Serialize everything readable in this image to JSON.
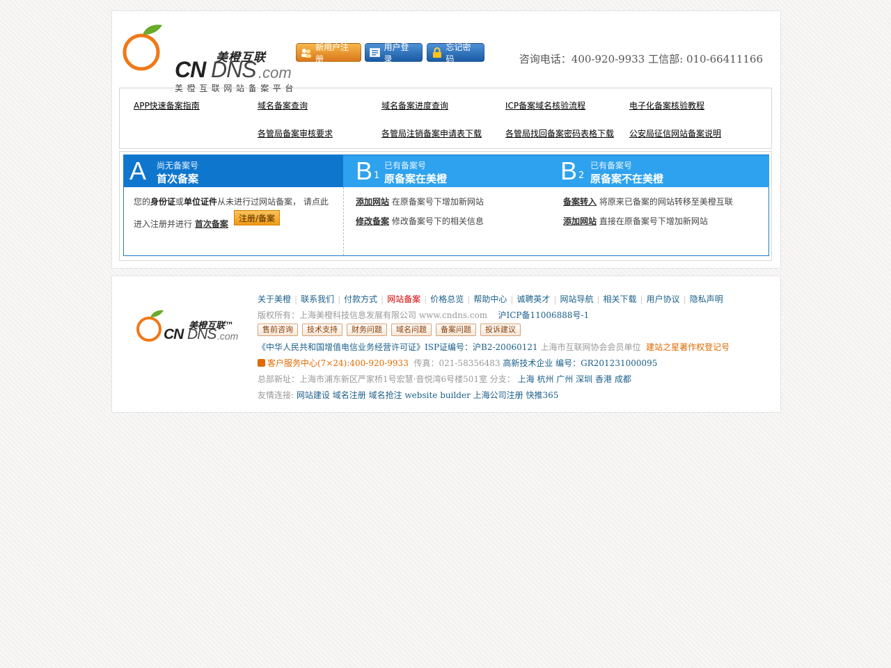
{
  "header": {
    "logo": {
      "title": "美橙互联",
      "cn": "CN",
      "dns": "DNS",
      "com": ".com",
      "subtitle": "美橙互联网站备案平台"
    },
    "buttons": {
      "register": "新用户注册",
      "login": "用户登录",
      "forgot": "忘记密码"
    },
    "hotline": "咨询电话：400-920-9933 工信部: 010-66411166"
  },
  "guide_links": [
    "APP快速备案指南",
    "域名备案查询",
    "域名备案进度查询",
    "ICP备案域名核验流程",
    "电子化备案核验教程",
    "各管局备案审核要求",
    "各管局注销备案申请表下载",
    "各管局找回备案密码表格下载",
    "公安局征信网站备案说明"
  ],
  "steps": {
    "a": {
      "letter": "A",
      "small": "尚无备案号",
      "big": "首次备案",
      "line1_pre": "您的",
      "line1_b1": "身份证",
      "line1_mid": "或",
      "line1_b2": "单位证件",
      "line1_post": "从未进行过网站备案， 请点此",
      "line2_pre": "进入注册并进行",
      "line2_link": "首次备案",
      "button": "注册/备案"
    },
    "b1": {
      "letter": "B",
      "num": "1",
      "small": "已有备案号",
      "big": "原备案在美橙",
      "items": [
        {
          "link": "添加网站",
          "desc": "在原备案号下增加新网站"
        },
        {
          "link": "修改备案",
          "desc": "修改备案号下的相关信息"
        }
      ]
    },
    "b2": {
      "letter": "B",
      "num": "2",
      "small": "已有备案号",
      "big": "原备案不在美橙",
      "items": [
        {
          "link": "备案转入",
          "desc": "将原来已备案的网站转移至美橙互联"
        },
        {
          "link": "添加网站",
          "desc": "直接在原备案号下增加新网站"
        }
      ]
    }
  },
  "footer": {
    "logo": {
      "title": "美橙互联™",
      "cn": "CN",
      "dns": "DNS",
      "com": ".com"
    },
    "nav": [
      "关于美橙",
      "联系我们",
      "付款方式",
      "网站备案",
      "价格总览",
      "帮助中心",
      "诚聘英才",
      "网站导航",
      "相关下载",
      "用户协议",
      "隐私声明"
    ],
    "copyright": "版权所有：上海美橙科技信息发展有限公司 www.cndns.com",
    "icp": "沪ICP备11006888号-1",
    "pills": [
      "售前咨询",
      "技术支持",
      "财务问题",
      "域名问题",
      "备案问题",
      "投诉建议"
    ],
    "license_link": "《中华人民共和国增值电信业务经营许可证》ISP证编号：沪B2-20060121",
    "member": "上海市互联网协会会员单位",
    "copyright_reg": "建站之星著作权登记号",
    "service": "客户服务中心(7×24):400-920-9933",
    "fax": "传真：021-58356483",
    "hightech": "高新技术企业 编号：GR201231000095",
    "address": "总部新址：上海市浦东新区严家桥1号宏慧·音悦湾6号楼501室 分支：",
    "branches": [
      "上海",
      "杭州",
      "广州",
      "深圳",
      "香港",
      "成都"
    ],
    "friends_label": "友情连接:",
    "friends": [
      "网站建设",
      "域名注册",
      "域名抢注",
      "website builder",
      "上海公司注册",
      "快推365"
    ]
  }
}
